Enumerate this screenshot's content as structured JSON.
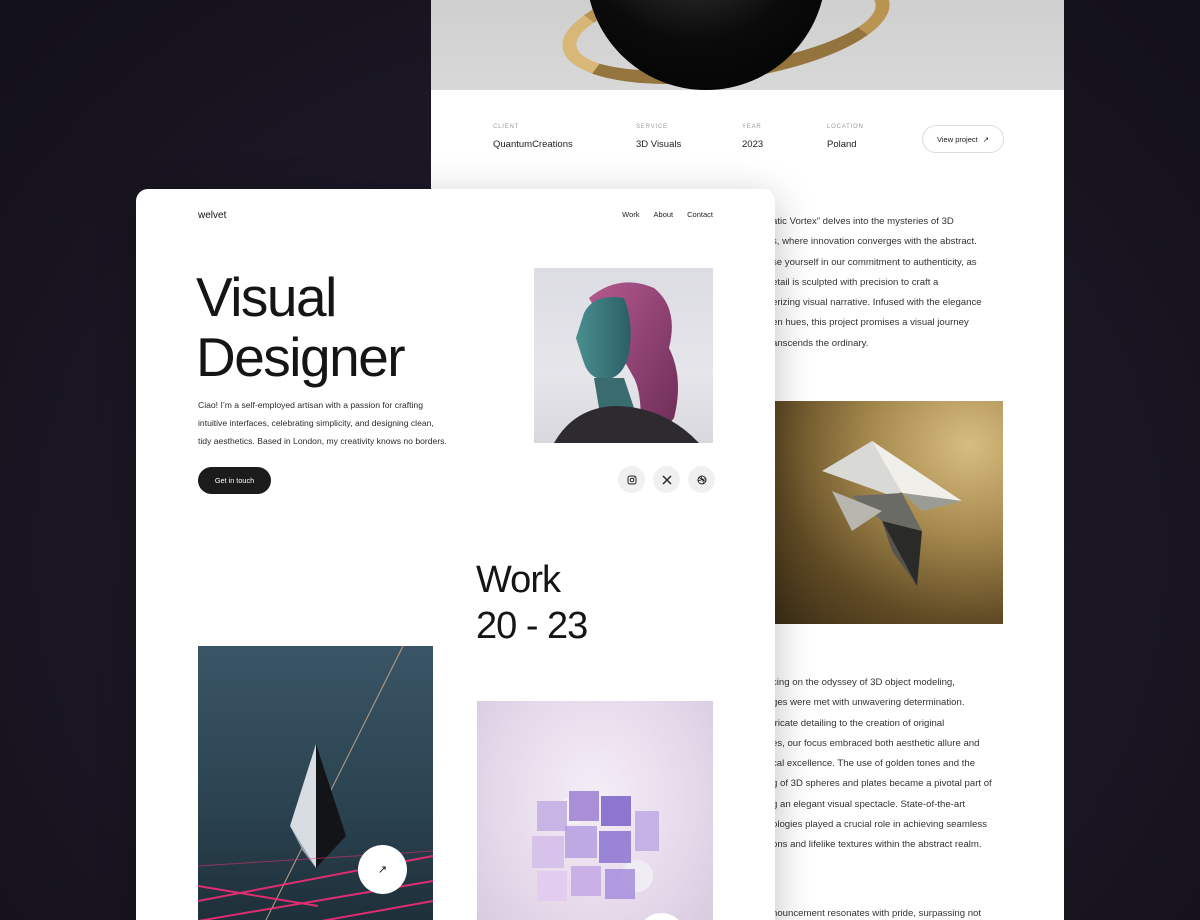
{
  "back_page": {
    "meta": [
      {
        "label": "CLIENT",
        "value": "QuantumCreations"
      },
      {
        "label": "SERVICE",
        "value": "3D Visuals"
      },
      {
        "label": "YEAR",
        "value": "2023"
      },
      {
        "label": "LOCATION",
        "value": "Poland"
      }
    ],
    "view_button": "View project",
    "desc1": [
      "atic Vortex” delves into the mysteries of 3D",
      "s, where innovation converges with the abstract.",
      "se yourself in our commitment to authenticity, as",
      "etail is sculpted with precision to craft a",
      "erizing visual narrative. Infused with the elegance",
      "en hues, this project promises a visual journey",
      "anscends the ordinary."
    ],
    "desc2": [
      "cing on the odyssey of 3D object modeling,",
      "ges were met with unwavering determination.",
      "tricate detailing to the creation of original",
      "es, our focus embraced both aesthetic allure and",
      "cal excellence. The use of golden tones and the",
      "g of 3D spheres and plates became a pivotal part of",
      "g an elegant visual spectacle. State-of-the-art",
      "ologies played a crucial role in achieving seamless",
      "ons and lifelike textures within the abstract realm."
    ],
    "desc3": "nouncement resonates with pride, surpassing not"
  },
  "front": {
    "logo": "welvet",
    "nav": [
      "Work",
      "About",
      "Contact"
    ],
    "title_lines": [
      "Visual",
      "Designer"
    ],
    "intro": [
      "Ciao! I’m a self-employed artisan with a passion for crafting",
      "intuitive interfaces, celebrating simplicity, and designing clean,",
      "tidy aesthetics. Based in London, my creativity knows no borders."
    ],
    "cta": "Get in touch",
    "socials": [
      "instagram-icon",
      "x-icon",
      "dribbble-icon"
    ],
    "work_title": [
      "Work",
      "20 - 23"
    ]
  }
}
